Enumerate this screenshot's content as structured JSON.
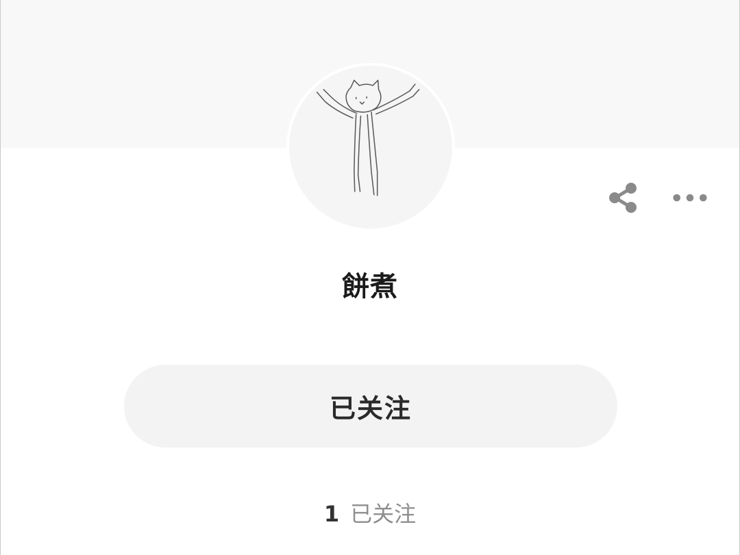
{
  "profile": {
    "username": "餅煮",
    "follow_button_label": "已关注",
    "following_count": "1",
    "following_label": "已关注"
  },
  "actions": {
    "share_icon": "share-icon",
    "more_icon": "more-dots-icon"
  },
  "colors": {
    "cover": "#f8f8f8",
    "button_bg": "#f3f3f3",
    "icon": "#8a8a8a",
    "text_primary": "#1b1b1b",
    "text_secondary": "#8e8e8e"
  }
}
